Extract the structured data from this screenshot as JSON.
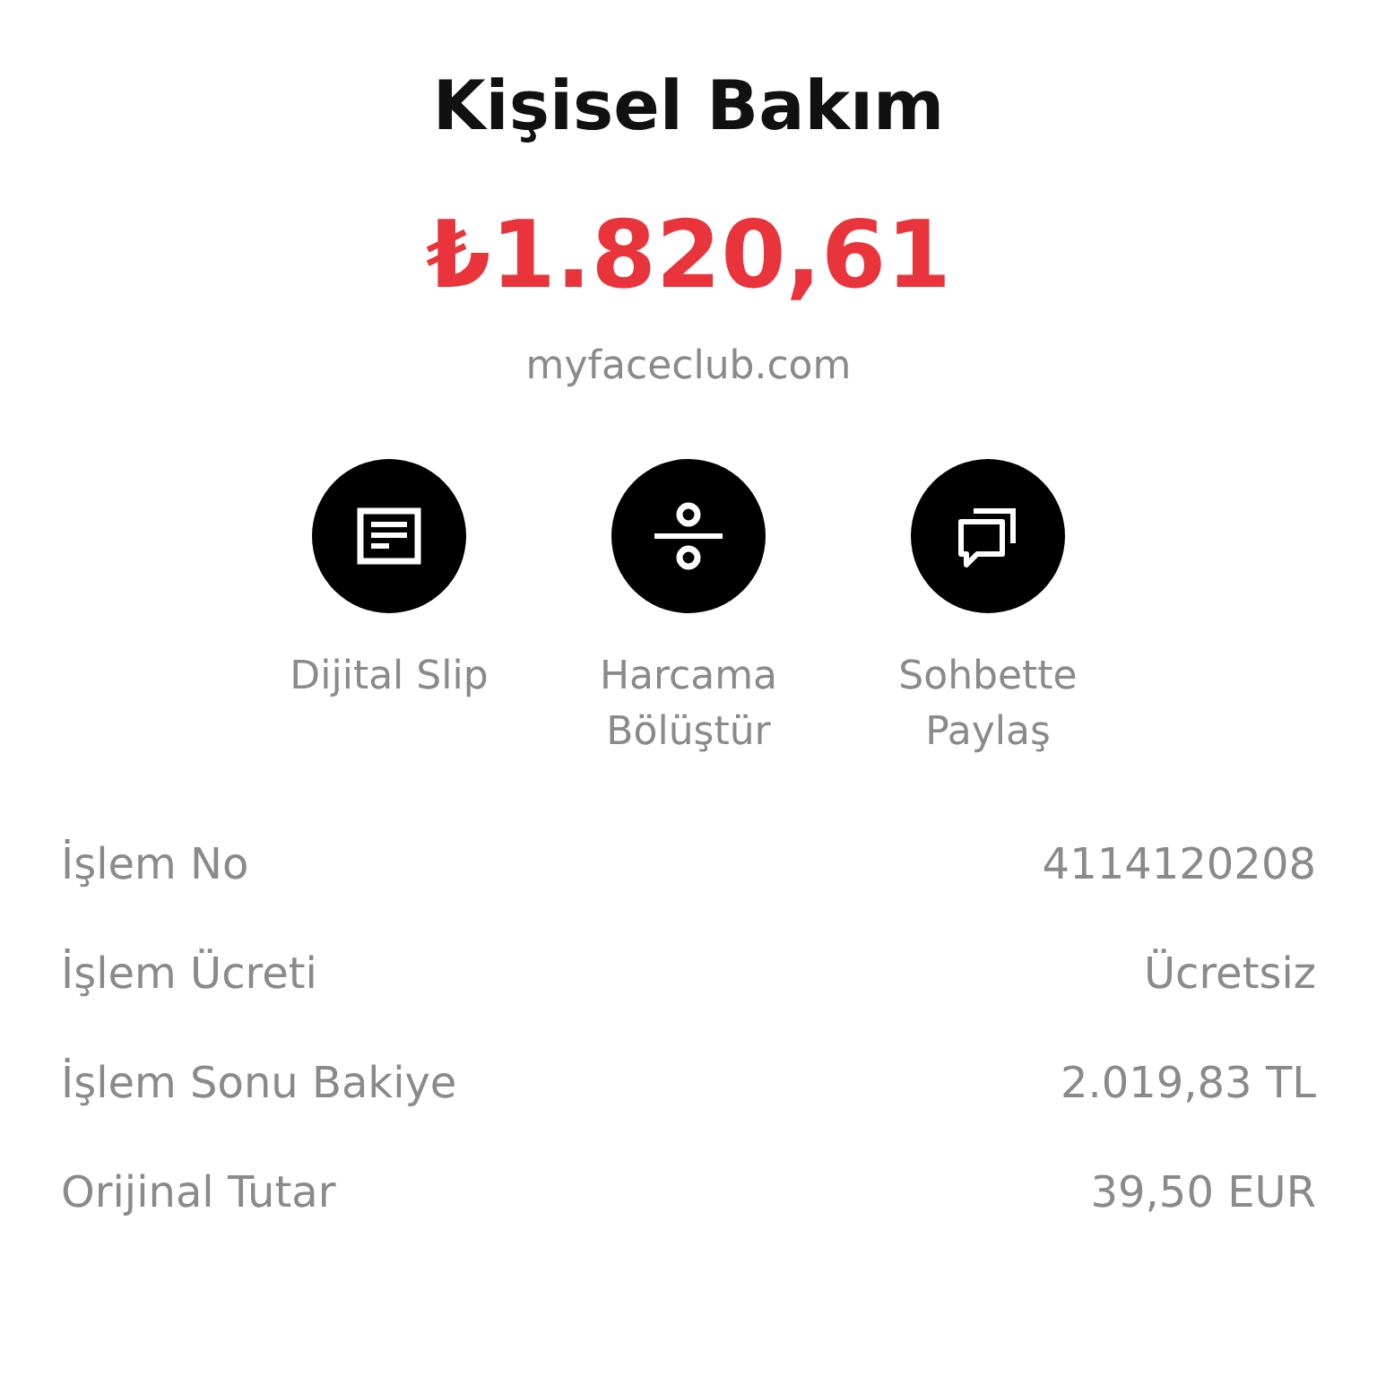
{
  "merchant": {
    "title": "Kişisel Bakım",
    "amount": "₺1.820,61",
    "domain": "myfaceclub.com"
  },
  "actions": [
    {
      "kind": "slip",
      "label": "Dijital Slip"
    },
    {
      "kind": "split",
      "label": "Harcama Bölüştür"
    },
    {
      "kind": "chat",
      "label": "Sohbette Paylaş"
    }
  ],
  "details": [
    {
      "label": "İşlem No",
      "value": "4114120208"
    },
    {
      "label": "İşlem Ücreti",
      "value": "Ücretsiz"
    },
    {
      "label": "İşlem Sonu Bakiye",
      "value": "2.019,83 TL"
    },
    {
      "label": "Orijinal Tutar",
      "value": "39,50 EUR"
    }
  ]
}
